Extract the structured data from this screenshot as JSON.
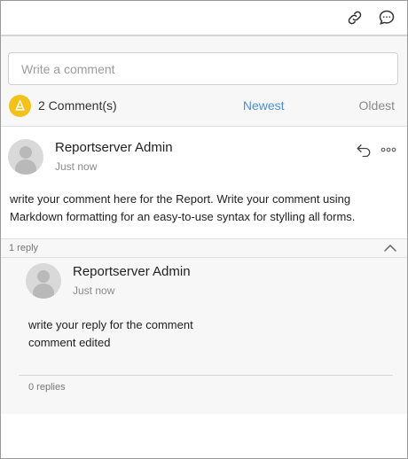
{
  "toolbar": {
    "link_icon": "link-icon",
    "chat_icon": "chat-bubble-icon"
  },
  "input": {
    "placeholder": "Write a comment",
    "value": ""
  },
  "summary": {
    "count_label": "2 Comment(s)",
    "newest_label": "Newest",
    "oldest_label": "Oldest",
    "badge_icon": "alert-bell-icon"
  },
  "comment": {
    "author": "Reportserver Admin",
    "time": "Just now",
    "body": "write your comment here for the Report. Write your comment using Markdown formatting for an easy-to-use syntax for stylling all forms.",
    "reply_count_label": "1 reply"
  },
  "reply": {
    "author": "Reportserver Admin",
    "time": "Just now",
    "body_line1": "write your reply for the comment",
    "body_line2": "comment edited",
    "replies_label": "0 replies"
  },
  "colors": {
    "accent": "#4a90d9",
    "badge": "#f2c21b",
    "muted": "#8a8a8a"
  }
}
